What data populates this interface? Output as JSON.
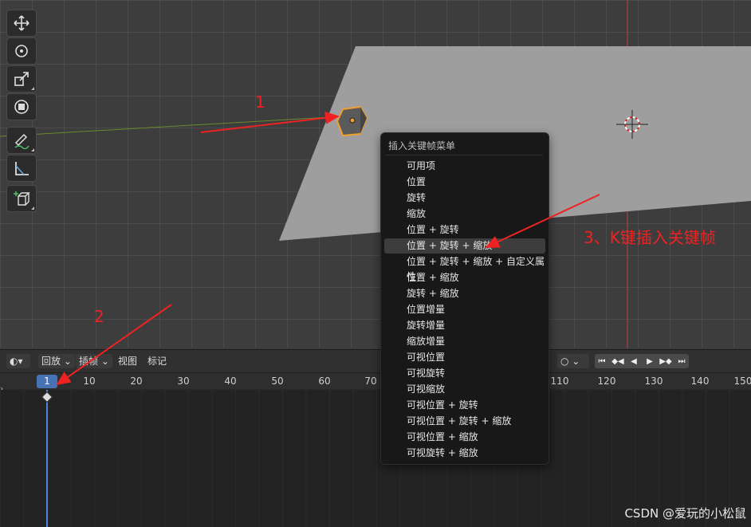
{
  "toolbar": {
    "tools": [
      {
        "name": "move-tool",
        "icon": "move-icon"
      },
      {
        "name": "rotate-tool",
        "icon": "rotate-icon"
      },
      {
        "name": "scale-tool",
        "icon": "scale-icon"
      },
      {
        "name": "transform-tool",
        "icon": "transform-icon"
      },
      {
        "name": "annotate-tool",
        "icon": "pencil-icon"
      },
      {
        "name": "measure-tool",
        "icon": "ruler-icon"
      },
      {
        "name": "add-cube-tool",
        "icon": "add-cube-icon"
      }
    ]
  },
  "menu": {
    "title": "插入关键帧菜单",
    "items": [
      "可用项",
      "位置",
      "旋转",
      "缩放",
      "位置 + 旋转",
      "位置 + 旋转 + 缩放",
      "位置 + 旋转 + 缩放 + 自定义属性",
      "位置 + 缩放",
      "旋转 + 缩放",
      "位置增量",
      "旋转增量",
      "缩放增量",
      "可视位置",
      "可视旋转",
      "可视缩放",
      "可视位置 + 旋转",
      "可视位置 + 旋转 + 缩放",
      "可视位置 + 缩放",
      "可视旋转 + 缩放"
    ],
    "active_item": "位置 + 旋转 + 缩放"
  },
  "timeline": {
    "header": {
      "playback": "回放",
      "keying": "插帧",
      "view": "视图",
      "marker": "标记"
    },
    "current_frame": "1",
    "ruler_labels": [
      "10",
      "20",
      "30",
      "40",
      "50",
      "60",
      "70",
      "110",
      "120",
      "130",
      "140",
      "150"
    ]
  },
  "annotations": {
    "step1": "1",
    "step2": "2",
    "step3": "3、K键插入关键帧"
  },
  "watermark": "CSDN @爱玩的小松鼠",
  "colors": {
    "accent_blue": "#4772b3",
    "selection_orange": "#f0a030",
    "annotation_red": "#ee2222"
  }
}
